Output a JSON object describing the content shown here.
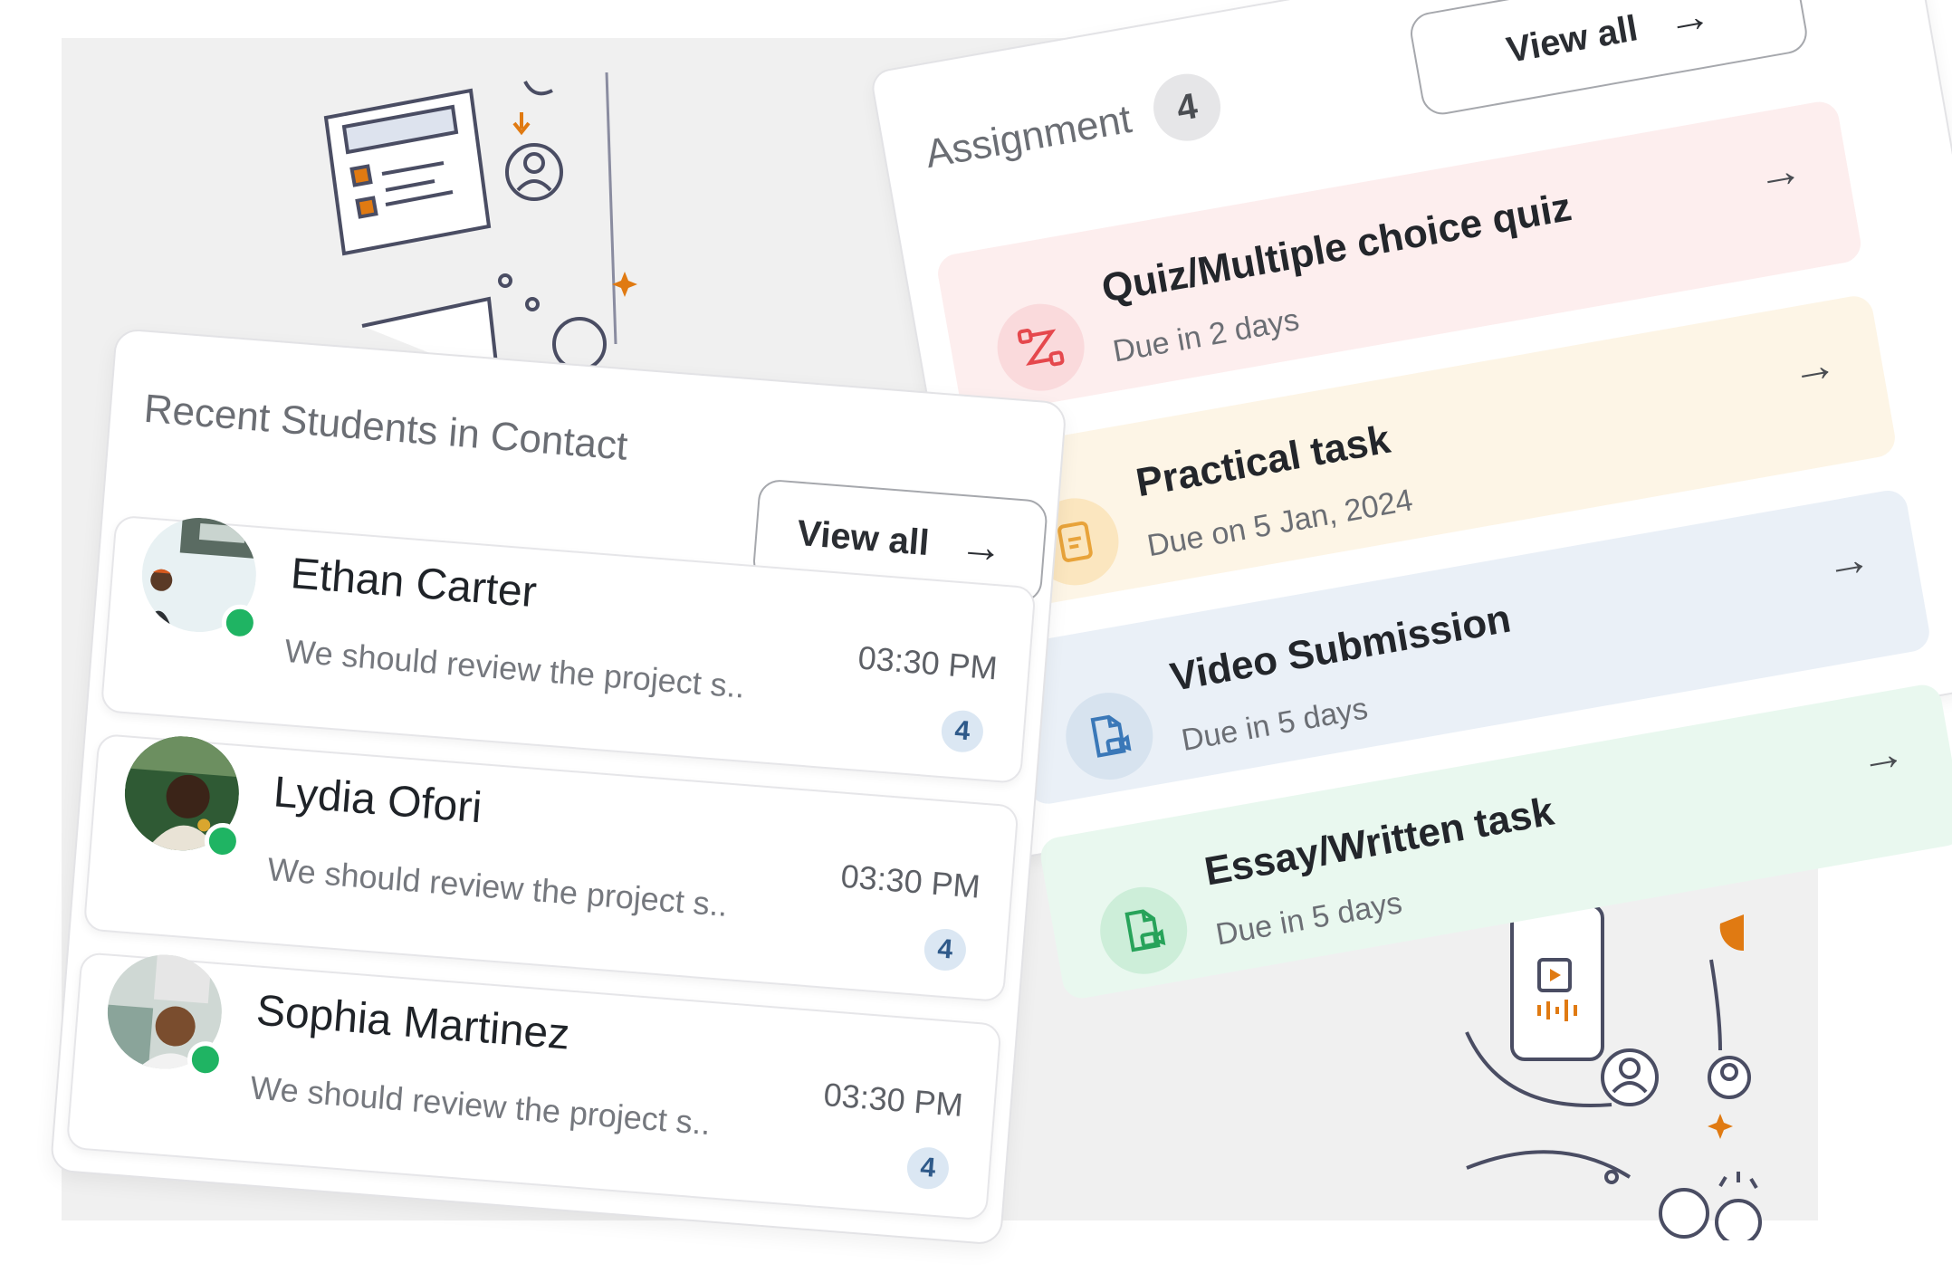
{
  "assignment": {
    "title": "Assignment",
    "count": "4",
    "view_all_label": "View all",
    "arrow_glyph": "→",
    "tasks": [
      {
        "name": "Quiz/Multiple choice quiz",
        "due": "Due in 2 days",
        "icon": "route-icon",
        "color": "#e5484d"
      },
      {
        "name": "Practical task",
        "due": "Due on 5 Jan, 2024",
        "icon": "task-icon",
        "color": "#e8a33a"
      },
      {
        "name": "Video Submission",
        "due": "Due in 5 days",
        "icon": "video-file-icon",
        "color": "#3a78b8"
      },
      {
        "name": "Essay/Written task",
        "due": "Due in 5 days",
        "icon": "video-file-icon",
        "color": "#27a35a"
      }
    ]
  },
  "students": {
    "title": "Recent Students in Contact",
    "view_all_label": "View all",
    "arrow_glyph": "→",
    "items": [
      {
        "name": "Ethan Carter",
        "message": "We should review the project s..",
        "time": "03:30 PM",
        "unread": "4",
        "online": true
      },
      {
        "name": "Lydia Ofori",
        "message": "We should review the project s..",
        "time": "03:30 PM",
        "unread": "4",
        "online": true
      },
      {
        "name": "Sophia Martinez",
        "message": "We should review the project s..",
        "time": "03:30 PM",
        "unread": "4",
        "online": true
      }
    ]
  },
  "colors": {
    "online": "#1fb463",
    "badge_bg": "#dbe7f3",
    "accent_orange": "#e07a12"
  }
}
